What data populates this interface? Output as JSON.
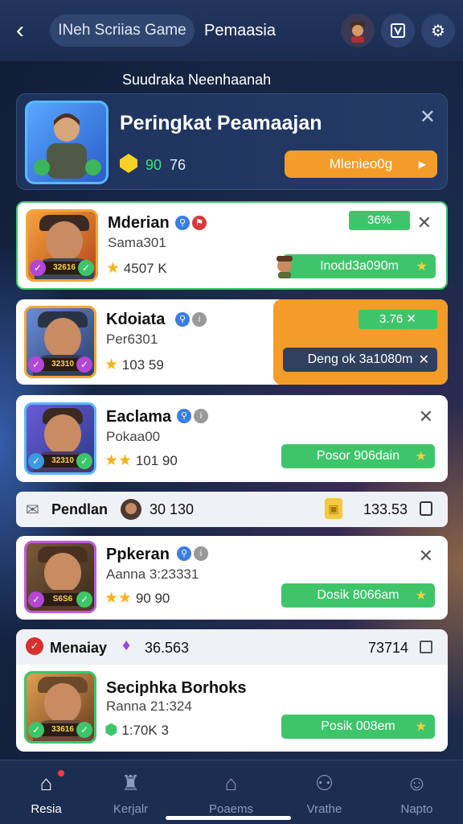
{
  "header": {
    "title_pill": "INeh Scriias Game",
    "title_2": "Pemaasia"
  },
  "subtitle": "Suudraka Neenhaanah",
  "hero": {
    "title": "Peringkat Peamaajan",
    "gem_value": "90",
    "value_2": "76",
    "button_label": "Mlenieo0g"
  },
  "games": [
    {
      "name": "Mderian",
      "sub": "Sama301",
      "rating": "4507 K",
      "tag": "32616",
      "percent": "36%",
      "action": "Inodd3a090m",
      "accent": "#f3a53a"
    },
    {
      "name": "Kdoiata",
      "sub": "Per6301",
      "rating": "103 59",
      "tag": "32310",
      "percent": "3.76",
      "action": "Deng ok 3a1080m",
      "accent": "#f3a53a"
    },
    {
      "name": "Eaclama",
      "sub": "Pokaa00",
      "rating": "101 90",
      "tag": "32310",
      "action": "Posor 906dain",
      "accent": "#59b8ff"
    },
    {
      "name": "Ppkeran",
      "sub": "Aanna 3:23331",
      "rating": "90 90",
      "tag": "S6S6",
      "action": "Dosik 8066am",
      "accent": "#c05ae0"
    },
    {
      "name": "Seciphka Borhoks",
      "sub": "Ranna 21:324",
      "rating": "1:70K 3",
      "tag": "33616",
      "action": "Posik 008em",
      "accent": "#3ec56a"
    }
  ],
  "bar1": {
    "label": "Pendlan",
    "value": "30 130",
    "right_value": "133.53"
  },
  "bar2": {
    "label": "Menaiay",
    "value": "36.563",
    "right_value": "73714"
  },
  "nav": [
    {
      "label": "Resia"
    },
    {
      "label": "Kerjalr"
    },
    {
      "label": "Poaems"
    },
    {
      "label": "Vrathe"
    },
    {
      "label": "Napto"
    }
  ]
}
